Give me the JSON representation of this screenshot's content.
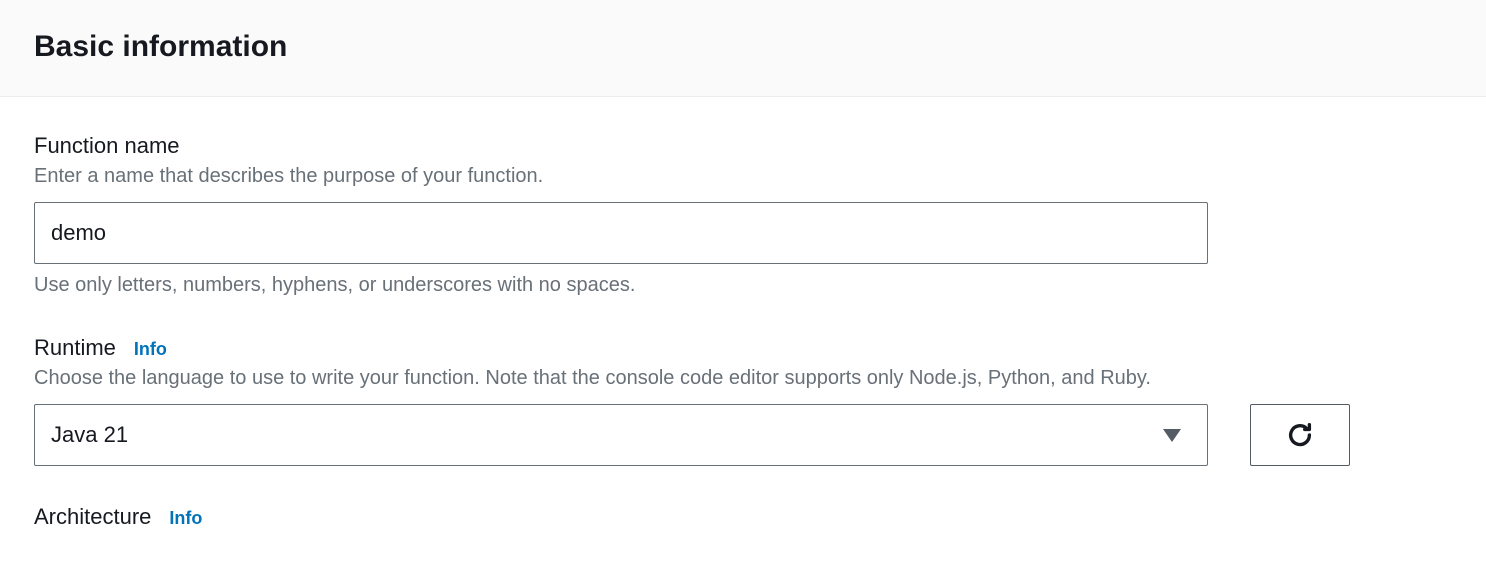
{
  "header": {
    "title": "Basic information"
  },
  "functionName": {
    "label": "Function name",
    "description": "Enter a name that describes the purpose of your function.",
    "value": "demo",
    "constraint": "Use only letters, numbers, hyphens, or underscores with no spaces."
  },
  "runtime": {
    "label": "Runtime",
    "infoLabel": "Info",
    "description": "Choose the language to use to write your function. Note that the console code editor supports only Node.js, Python, and Ruby.",
    "selected": "Java 21"
  },
  "architecture": {
    "label": "Architecture",
    "infoLabel": "Info"
  }
}
